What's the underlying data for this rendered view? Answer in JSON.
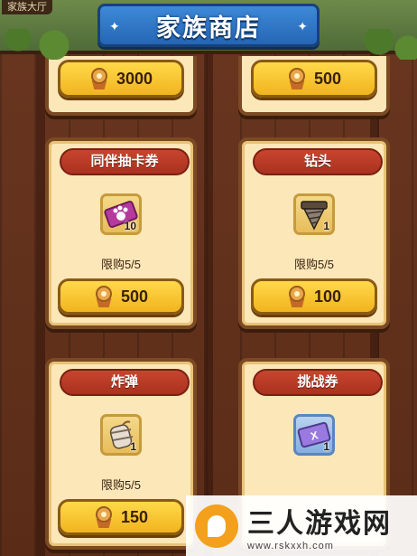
{
  "header": {
    "title": "家族商店",
    "hall_tag": "家族大厅"
  },
  "top_row": [
    {
      "price": "3000"
    },
    {
      "price": "500"
    }
  ],
  "cards": [
    {
      "name": "同伴抽卡券",
      "icon": "paw-ticket-icon",
      "count": "10",
      "limit": "限购5/5",
      "price": "500"
    },
    {
      "name": "钻头",
      "icon": "drill-icon",
      "count": "1",
      "limit": "限购5/5",
      "price": "100"
    },
    {
      "name": "炸弹",
      "icon": "bomb-icon",
      "count": "1",
      "limit": "限购5/5",
      "price": "150"
    },
    {
      "name": "挑战券",
      "icon": "challenge-ticket-icon",
      "count": "1",
      "limit": "",
      "price": ""
    }
  ],
  "watermark": {
    "main": "三人游戏网",
    "url": "www.rskxxh.com"
  },
  "colors": {
    "banner_blue": "#2f78c8",
    "ribbon_red": "#c8452e",
    "button_gold": "#f5c42c",
    "card_cream": "#fbe7b8",
    "wood_brown": "#5b2e1a"
  }
}
